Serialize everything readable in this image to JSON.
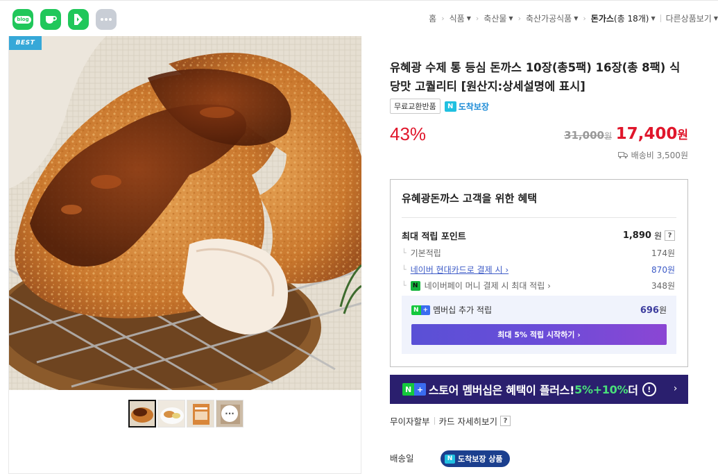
{
  "share": {
    "blog_label": "blog",
    "items": [
      "blog-icon",
      "naver-cafe-icon",
      "naver-band-icon",
      "more-icon"
    ]
  },
  "breadcrumb": {
    "items": [
      {
        "label": "홈",
        "has_caret": false
      },
      {
        "label": "식품",
        "has_caret": true
      },
      {
        "label": "축산물",
        "has_caret": true
      },
      {
        "label": "축산가공식품",
        "has_caret": true
      }
    ],
    "current": {
      "label": "돈가스",
      "count": "(총 18개)"
    },
    "other": "다른상품보기"
  },
  "gallery": {
    "badge": "BEST",
    "thumbnails": [
      "thumbnail-1",
      "thumbnail-2",
      "thumbnail-3",
      "thumbnail-4"
    ],
    "active_index": 0,
    "more_glyph": "···"
  },
  "product": {
    "title": "유혜광 수제 통 등심 돈까스 10장(총5팩) 16장(총 8팩) 식당맛 고퀄리티 [원산지:상세설명에 표시]",
    "tag_free_return": "무료교환반품",
    "tag_delivery": "도착보장",
    "n_mark": "N",
    "discount": "43%",
    "original_price": "31,000",
    "original_won": "원",
    "sale_price": "17,400",
    "sale_won": "원",
    "shipping_fee": "배송비 3,500원"
  },
  "benefit": {
    "title": "유혜광돈까스 고객을 위한 혜택",
    "max_points_label": "최대 적립 포인트",
    "max_points_value": "1,890",
    "won": "원",
    "help": "?",
    "rows": [
      {
        "label": "기본적립",
        "value": "174원",
        "link": false
      },
      {
        "label": "네이버 현대카드로 결제 시 ›",
        "value": "870원",
        "link": true
      },
      {
        "label": "네이버페이 머니 결제 시 최대 적립 ›",
        "value": "348원",
        "link": false
      }
    ],
    "membership_label": "멤버십 추가 적립",
    "membership_value": "696",
    "membership_button": "최대 5% 적립 시작하기 ›"
  },
  "store_banner": {
    "text_1": "스토어 멤버십은 혜택이 플러스! ",
    "highlight": "5%+10%",
    "text_2": " 더",
    "excl": "!",
    "chevron": "›"
  },
  "payment": {
    "interest_free": "무이자할부",
    "card_detail": "카드 자세히보기",
    "help": "?"
  },
  "delivery": {
    "label": "배송일",
    "badge": "도착보장 상품"
  },
  "colors": {
    "price_red": "#e0162b",
    "naver_green": "#14c83c",
    "link_blue": "#3d5bc7",
    "banner_navy": "#2a1f6e",
    "best_badge": "#36a8d8"
  }
}
